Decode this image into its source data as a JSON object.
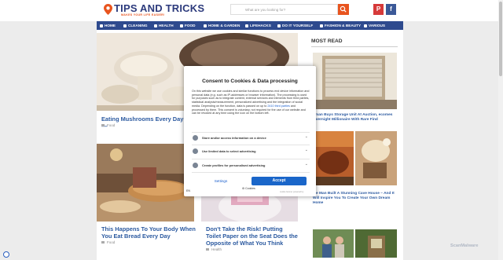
{
  "site": {
    "logo_text": "TIPS AND TRICKS",
    "tagline": "MAKES YOUR LIFE EASIER!",
    "search_placeholder": "What are you looking for?",
    "social": {
      "pinterest": "P",
      "facebook": "f"
    }
  },
  "nav": {
    "items": [
      {
        "label": "HOME",
        "icon": "home-icon"
      },
      {
        "label": "CLEANING",
        "icon": "broom-icon"
      },
      {
        "label": "HEALTH",
        "icon": "heart-icon"
      },
      {
        "label": "FOOD",
        "icon": "food-icon"
      },
      {
        "label": "HOME & GARDEN",
        "icon": "house-icon"
      },
      {
        "label": "LIFEHACKS",
        "icon": "bulb-icon"
      },
      {
        "label": "DO IT YOURSELF",
        "icon": "wrench-icon"
      },
      {
        "label": "FASHION & BEAUTY",
        "icon": "shirt-icon"
      },
      {
        "label": "VARIOUS",
        "icon": "star-icon"
      }
    ]
  },
  "articles": [
    {
      "title": "Eating Mushrooms Every Day —",
      "category": "Food"
    },
    {
      "title": "This Happens To Your Body When You Eat Bread Every Day",
      "category": "Food"
    },
    {
      "title": "Don't Take the Risk! Putting Toilet Paper on the Seat Does the Opposite of What You Think",
      "category": "Health"
    }
  ],
  "sidebar": {
    "heading": "MOST READ",
    "items": [
      {
        "title": "oman Buys Storage Unit At Auction, ecomes Overnight Millionaire With Rare Find"
      },
      {
        "title": "ale Man Built A Stunning Cave House – And It Will Inspire You To Create Your Own Dream Home"
      }
    ]
  },
  "consent": {
    "title": "Consent to Cookies & Data processing",
    "body_before_link": "On this website we use cookies and similar functions to process end device information and personal data (e.g. such as IP-addresses or browser information). The processing is used for purposes such as to integrate content, external services and elements from third parties, statistical analysis/measurement, personalized advertising and the integration of social media. Depending on the function, data is passed on up to",
    "link_text": "2410 third parties",
    "body_after_link": "and processed by them. This consent is voluntary, not required for the use of our website and can be revoked at any time using the icon on the bottom left.",
    "options": [
      "Store and/or access information on a device",
      "Use limited data to select advertising",
      "Create profiles for personalised advertising"
    ],
    "settings_label": "Settings",
    "accept_label": "Accept",
    "cookies_label": "Cookies",
    "language": "EN",
    "powered": "cookie banner powered by"
  },
  "watermark": "ScanMalware"
}
